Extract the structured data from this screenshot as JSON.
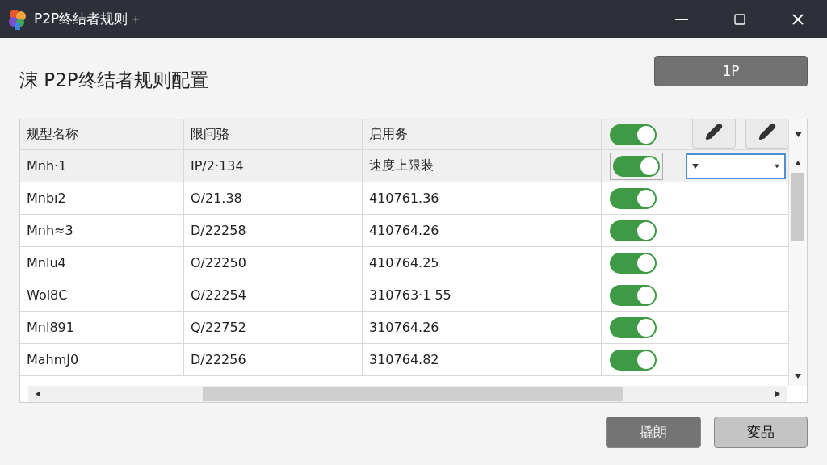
{
  "window": {
    "title": "P2P终结者规则"
  },
  "heading": "涑 P2P终结者规则配置",
  "top_button": "1P",
  "table": {
    "columns": [
      "规型名称",
      "限问骆",
      "启用务"
    ],
    "header_toggle_on": true,
    "rows": [
      {
        "name": "Mnh·1",
        "column_2": "IP/2·134",
        "column_3": "速度上限装",
        "enabled": true,
        "selected": true
      },
      {
        "name": "Mnbı2",
        "column_2": "O/21.38",
        "column_3": "410761.36",
        "enabled": true,
        "selected": false
      },
      {
        "name": "Mnh≈3",
        "column_2": "D/22258",
        "column_3": "410764.26",
        "enabled": true,
        "selected": false
      },
      {
        "name": "Mnlu4",
        "column_2": "O/22250",
        "column_3": "410764.25",
        "enabled": true,
        "selected": false
      },
      {
        "name": "Wol8C",
        "column_2": "O/22254",
        "column_3": "310763·1 55",
        "enabled": true,
        "selected": false
      },
      {
        "name": "Mnl891",
        "column_2": "Q/22752",
        "column_3": "310764.26",
        "enabled": true,
        "selected": false
      },
      {
        "name": "MahmJ0",
        "column_2": "D/22256",
        "column_3": "310764.82",
        "enabled": true,
        "selected": false
      }
    ]
  },
  "buttons": [
    "撬朗",
    "変品"
  ]
}
